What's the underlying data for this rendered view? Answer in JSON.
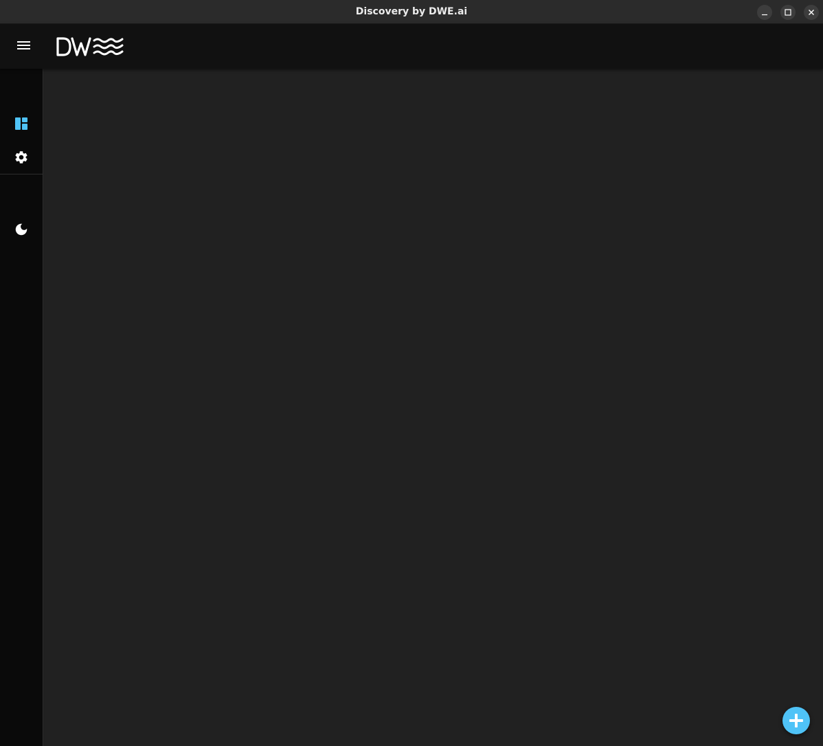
{
  "window": {
    "title": "Discovery by DWE.ai",
    "controls": [
      "minimize",
      "maximize",
      "close"
    ]
  },
  "header": {
    "menu_icon": "hamburger-menu-icon",
    "logo_text": "DWE"
  },
  "sidebar": {
    "items": [
      {
        "id": "dashboard",
        "icon": "dashboard-icon",
        "active": true
      },
      {
        "id": "settings",
        "icon": "gear-icon",
        "active": false
      }
    ],
    "footer_items": [
      {
        "id": "theme",
        "icon": "moon-icon"
      }
    ]
  },
  "fab": {
    "icon": "plus-icon"
  },
  "colors": {
    "accent": "#4fc3f7",
    "titlebar": "#2b2b2b",
    "header": "#111111",
    "sidebar": "#0a0a0a",
    "main": "#212121"
  }
}
